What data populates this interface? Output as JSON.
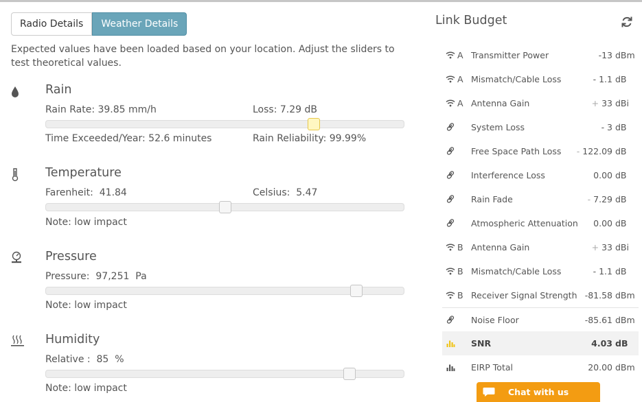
{
  "tabs": [
    {
      "label": "Radio Details",
      "active": false
    },
    {
      "label": "Weather Details",
      "active": true
    }
  ],
  "intro": "Expected values have been loaded based on your location. Adjust the sliders to test theoretical values.",
  "rain": {
    "title": "Rain",
    "icon": "drop-icon",
    "rate": "Rain Rate: 39.85 mm/h",
    "loss": "Loss: 7.29 dB",
    "time": "Time Exceeded/Year: 52.6 minutes",
    "reliability": "Rain Reliability: 99.99%",
    "slider": 0.749
  },
  "temperature": {
    "title": "Temperature",
    "icon": "thermometer-icon",
    "fahrenheit": "Farenheit:  41.84",
    "celsius": "Celsius:  5.47",
    "note": "Note: low impact",
    "slider": 0.5
  },
  "pressure": {
    "title": "Pressure",
    "icon": "barometer-icon",
    "value": "Pressure:  97,251  Pa",
    "note": "Note: low impact",
    "slider": 0.868
  },
  "humidity": {
    "title": "Humidity",
    "icon": "humidity-icon",
    "value": "Relative :  85  %",
    "note": "Note: low impact",
    "slider": 0.849
  },
  "link_budget": {
    "title": "Link Budget",
    "refresh_icon": "refresh-icon",
    "rows": [
      {
        "icon": "wifi-icon",
        "side": "A",
        "label": "Transmitter Power",
        "sign": "",
        "value": "-13",
        "unit": "dBm"
      },
      {
        "icon": "wifi-icon",
        "side": "A",
        "label": "Mismatch/Cable Loss",
        "sign": "",
        "value": "- 1.1",
        "unit": "dB"
      },
      {
        "icon": "wifi-icon",
        "side": "A",
        "label": "Antenna Gain",
        "sign": "+",
        "value": "33",
        "unit": "dBi"
      },
      {
        "icon": "link-icon",
        "side": "",
        "label": "System Loss",
        "sign": "",
        "value": "- 3",
        "unit": "dB"
      },
      {
        "icon": "link-icon",
        "side": "",
        "label": "Free Space Path Loss",
        "sign": "-",
        "value": "122.09",
        "unit": "dB"
      },
      {
        "icon": "link-icon",
        "side": "",
        "label": "Interference Loss",
        "sign": "",
        "value": "0.00",
        "unit": "dB"
      },
      {
        "icon": "link-icon",
        "side": "",
        "label": "Rain Fade",
        "sign": "-",
        "value": "7.29",
        "unit": "dB"
      },
      {
        "icon": "link-icon",
        "side": "",
        "label": "Atmospheric Attenuation",
        "sign": "",
        "value": "0.00",
        "unit": "dB"
      },
      {
        "icon": "wifi-icon",
        "side": "B",
        "label": "Antenna Gain",
        "sign": "+",
        "value": "33",
        "unit": "dBi"
      },
      {
        "icon": "wifi-icon",
        "side": "B",
        "label": "Mismatch/Cable Loss",
        "sign": "",
        "value": "- 1.1",
        "unit": "dB"
      },
      {
        "icon": "wifi-icon",
        "side": "B",
        "label": "Receiver Signal Strength",
        "sign": "",
        "value": "-81.58",
        "unit": "dBm"
      },
      {
        "icon": "link-icon",
        "side": "",
        "label": "Noise Floor",
        "sign": "",
        "value": "-85.61",
        "unit": "dBm"
      },
      {
        "icon": "bar-chart-icon",
        "side": "",
        "label": "SNR",
        "sign": "",
        "value": "4.03",
        "unit": "dB"
      },
      {
        "icon": "bar-chart-icon",
        "side": "",
        "label": "EIRP Total",
        "sign": "",
        "value": "20.00",
        "unit": "dBm"
      }
    ]
  },
  "chat": {
    "label": "Chat with us",
    "icon": "chat-bubble-icon"
  },
  "colors": {
    "tab_active": "#6aa5b9",
    "chat": "#f39c12",
    "snr_icon": "#f0c419",
    "slider_focus": "#fff7c2"
  }
}
